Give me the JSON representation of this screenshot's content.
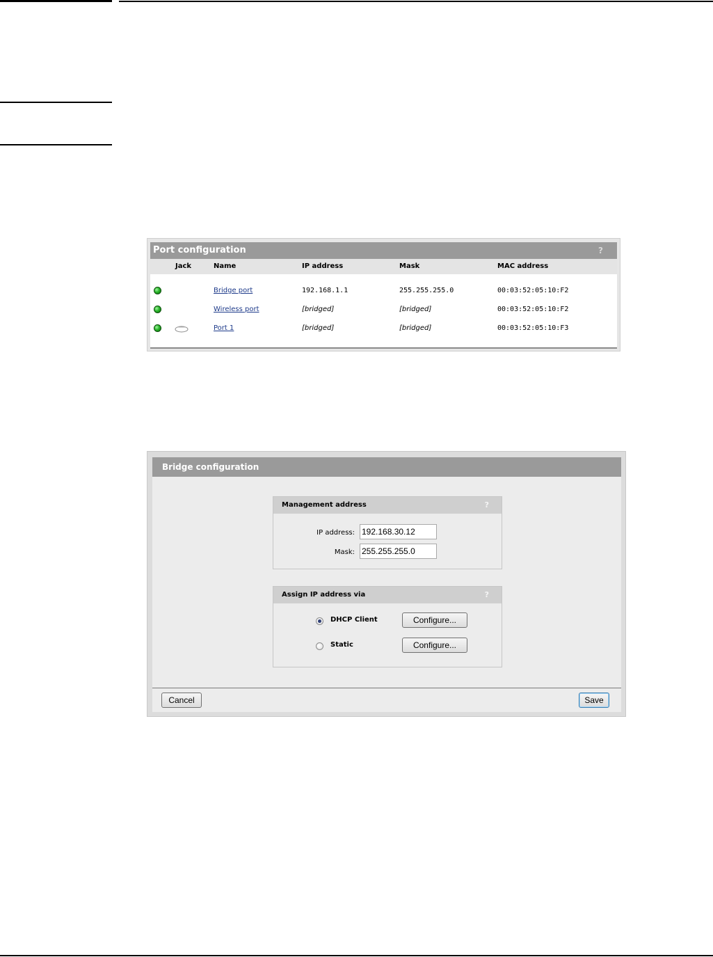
{
  "port_config": {
    "title": "Port configuration",
    "help": "?",
    "columns": {
      "jack": "Jack",
      "name": "Name",
      "ip": "IP address",
      "mask": "Mask",
      "mac": "MAC address"
    },
    "rows": [
      {
        "status": "up",
        "jack_icon": "",
        "name": "Bridge port",
        "ip": "192.168.1.1",
        "mask": "255.255.255.0",
        "mac": "00:03:52:05:10:F2"
      },
      {
        "status": "up",
        "jack_icon": "",
        "name": "Wireless port",
        "ip": "[bridged]",
        "mask": "[bridged]",
        "mac": "00:03:52:05:10:F2"
      },
      {
        "status": "up",
        "jack_icon": "ethernet-jack-icon",
        "name": "Port 1",
        "ip": "[bridged]",
        "mask": "[bridged]",
        "mac": "00:03:52:05:10:F3"
      }
    ],
    "status_color": "#2bb52b"
  },
  "bridge_config": {
    "title": "Bridge configuration",
    "management": {
      "title": "Management address",
      "help": "?",
      "ip_label": "IP address:",
      "ip_value": "192.168.30.12",
      "mask_label": "Mask:",
      "mask_value": "255.255.255.0"
    },
    "assign": {
      "title": "Assign IP address via",
      "help": "?",
      "options": [
        {
          "label": "DHCP Client",
          "selected": true,
          "button": "Configure..."
        },
        {
          "label": "Static",
          "selected": false,
          "button": "Configure..."
        }
      ]
    },
    "cancel_label": "Cancel",
    "save_label": "Save"
  }
}
